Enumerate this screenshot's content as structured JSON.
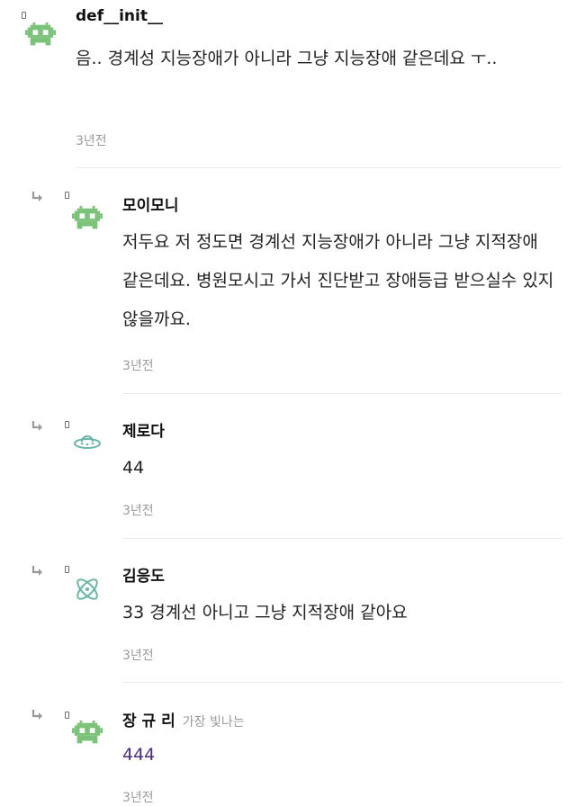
{
  "comments": [
    {
      "author": "def__init__",
      "text": "음.. 경계성 지능장애가 아니라 그냥 지능장애 같은데요 ㅜ..",
      "time": "3년전",
      "avatar_icon": "pixel-robot-icon"
    },
    {
      "author": "모이모니",
      "text": "저두요 저 정도면 경계선 지능장애가 아니라 그냥 지적장애 같은데요. 병원모시고 가서 진단받고 장애등급 받으실수 있지 않을까요.",
      "time": "3년전",
      "avatar_icon": "pixel-robot-icon"
    },
    {
      "author": "제로다",
      "text": "44",
      "time": "3년전",
      "avatar_icon": "ufo-icon"
    },
    {
      "author": "김응도",
      "text": "33 경계선 아니고 그냥 지적장애 같아요",
      "time": "3년전",
      "avatar_icon": "atom-icon"
    },
    {
      "author": "장 규 리",
      "badge": "가장 빛나는",
      "text": "444",
      "time": "3년전",
      "avatar_icon": "pixel-robot-icon"
    }
  ],
  "colors": {
    "avatar_green": "#7cc37a",
    "text_purple": "#4b2d83"
  }
}
